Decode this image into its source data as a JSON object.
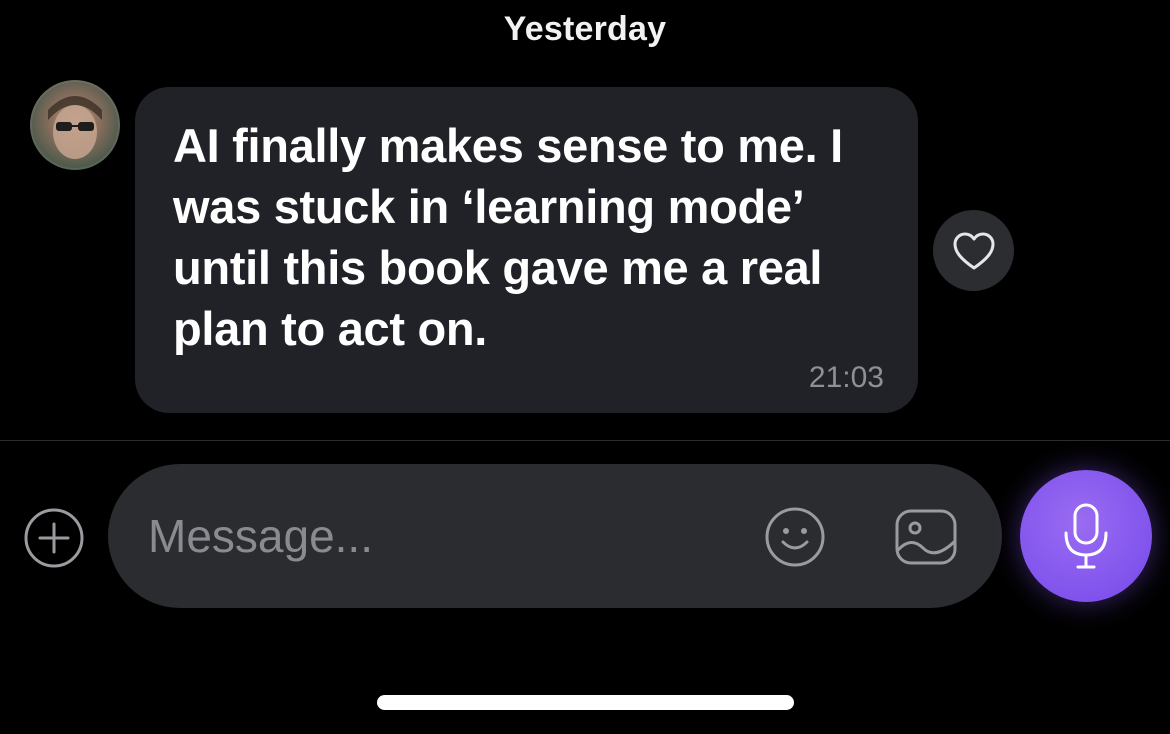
{
  "header": {
    "date_label": "Yesterday"
  },
  "message": {
    "sender_avatar": "user-avatar",
    "text": "AI finally makes sense to me. I was stuck in ‘learning mode’ until this book gave me a real plan to act on.",
    "time": "21:03",
    "reaction_icon": "heart-icon"
  },
  "composer": {
    "placeholder": "Message...",
    "value": "",
    "add_icon": "plus-circle-icon",
    "emoji_icon": "smiley-icon",
    "image_icon": "image-icon",
    "mic_icon": "microphone-icon"
  },
  "colors": {
    "background": "#000000",
    "bubble": "#202227",
    "composer": "#2a2c30",
    "mic_accent": "#8457ee",
    "muted_text": "#8e9096"
  }
}
